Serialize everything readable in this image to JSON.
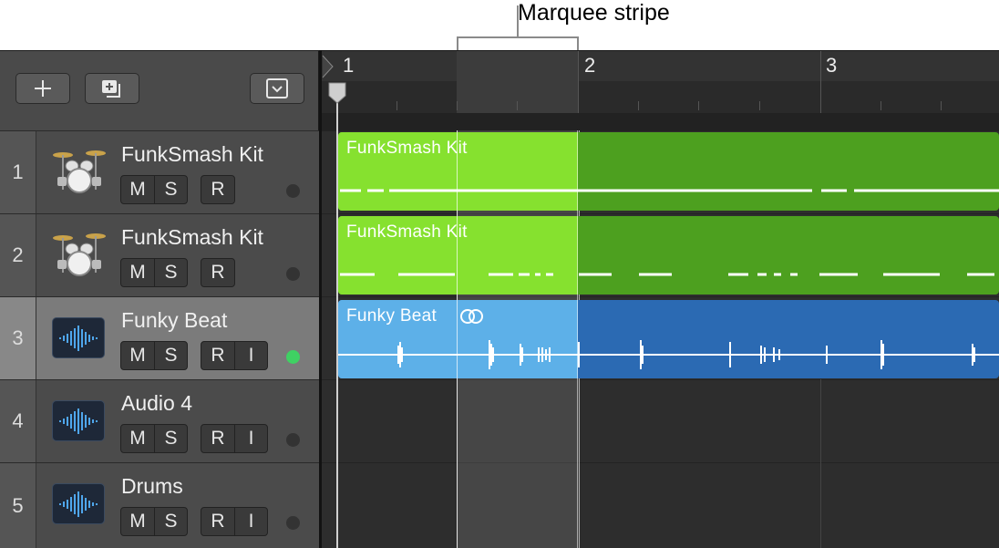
{
  "callout": {
    "label": "Marquee stripe"
  },
  "toolbar": {
    "add_icon": "plus-icon",
    "duplicate_icon": "duplicate-track-icon",
    "dropdown_icon": "chevron-down-icon"
  },
  "ruler": {
    "bars": [
      "1",
      "2",
      "3"
    ]
  },
  "tracks": [
    {
      "number": "1",
      "name": "FunkSmash Kit",
      "icon": "drum-kit-icon",
      "buttons": [
        "M",
        "S",
        "R"
      ],
      "record_enabled": false,
      "selected": false
    },
    {
      "number": "2",
      "name": "FunkSmash Kit",
      "icon": "drum-kit-icon",
      "buttons": [
        "M",
        "S",
        "R"
      ],
      "record_enabled": false,
      "selected": false
    },
    {
      "number": "3",
      "name": "Funky Beat",
      "icon": "audio-waveform-icon",
      "buttons": [
        "M",
        "S",
        "R",
        "I"
      ],
      "record_enabled": true,
      "selected": true
    },
    {
      "number": "4",
      "name": "Audio 4",
      "icon": "audio-waveform-icon",
      "buttons": [
        "M",
        "S",
        "R",
        "I"
      ],
      "record_enabled": false,
      "selected": false
    },
    {
      "number": "5",
      "name": "Drums",
      "icon": "audio-waveform-icon",
      "buttons": [
        "M",
        "S",
        "R",
        "I"
      ],
      "record_enabled": false,
      "selected": false
    }
  ],
  "regions": [
    {
      "label": "FunkSmash Kit",
      "color": "#4da01f"
    },
    {
      "label": "FunkSmash Kit",
      "color": "#4da01f"
    },
    {
      "label": "Funky Beat",
      "color": "#2b6ab3",
      "loop_icon": "loop-rings-icon"
    }
  ],
  "colors": {
    "led_on": "#3fd163",
    "marquee_green": "#86e12f",
    "marquee_blue": "#5db0e8"
  }
}
